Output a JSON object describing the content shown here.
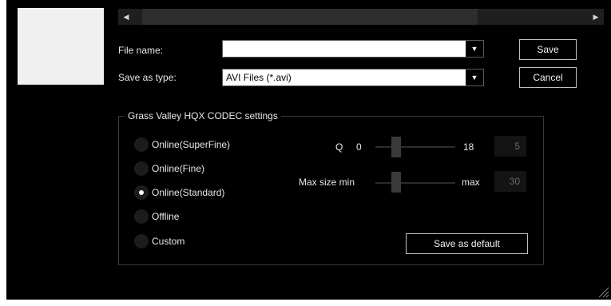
{
  "scrollbar": {
    "left_arrow": "◀",
    "right_arrow": "▶"
  },
  "file": {
    "name_label": "File name:",
    "name_value": "",
    "type_label": "Save as type:",
    "type_value": "AVI Files (*.avi)",
    "dropdown_glyph": "▼"
  },
  "buttons": {
    "save": "Save",
    "cancel": "Cancel"
  },
  "codec": {
    "title": "Grass Valley HQX CODEC settings",
    "options": [
      {
        "label": "Online(SuperFine)",
        "selected": false
      },
      {
        "label": "Online(Fine)",
        "selected": false
      },
      {
        "label": "Online(Standard)",
        "selected": true
      },
      {
        "label": "Offline",
        "selected": false
      },
      {
        "label": "Custom",
        "selected": false
      }
    ],
    "q": {
      "label": "Q",
      "min": "0",
      "max": "18",
      "value": "5"
    },
    "size": {
      "label_min": "Max size min",
      "label_max": "max",
      "value": "30"
    },
    "save_default": "Save as default"
  },
  "colors": {
    "background": "#000000",
    "text": "#e8e8e8",
    "disabled_text": "#6b6b6b"
  }
}
